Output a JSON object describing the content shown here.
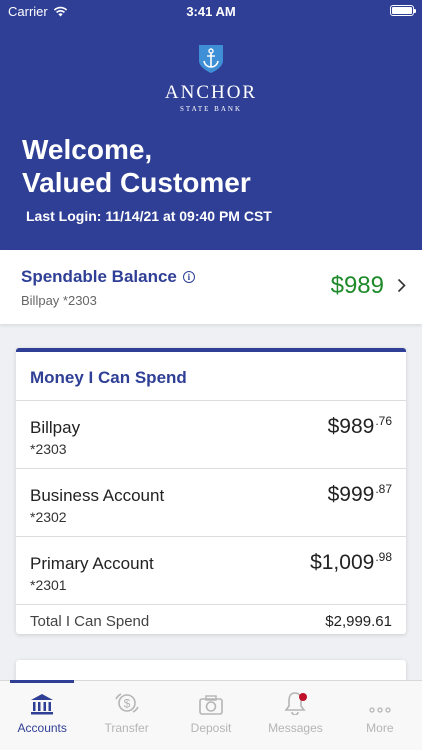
{
  "status_bar": {
    "carrier": "Carrier",
    "time": "3:41 AM"
  },
  "brand": {
    "name": "ANCHOR",
    "subtitle": "STATE BANK"
  },
  "welcome": {
    "line1": "Welcome,",
    "line2": "Valued Customer",
    "last_login": "Last Login: 11/14/21 at 09:40 PM CST"
  },
  "spendable": {
    "title": "Spendable Balance",
    "account": "Billpay *2303",
    "amount": "$989"
  },
  "money_card": {
    "title": "Money I Can Spend",
    "accounts": [
      {
        "name": "Billpay",
        "number": "*2303",
        "dollars": "$989",
        "cents": ".76"
      },
      {
        "name": "Business Account",
        "number": "*2302",
        "dollars": "$999",
        "cents": ".87"
      },
      {
        "name": "Primary Account",
        "number": "*2301",
        "dollars": "$1,009",
        "cents": ".98"
      }
    ],
    "total_label": "Total I Can Spend",
    "total_amount": "$2,999.61"
  },
  "tabs": [
    {
      "label": "Accounts",
      "icon": "bank-icon",
      "active": true
    },
    {
      "label": "Transfer",
      "icon": "transfer-dollar-icon",
      "active": false
    },
    {
      "label": "Deposit",
      "icon": "camera-icon",
      "active": false
    },
    {
      "label": "Messages",
      "icon": "bell-icon",
      "active": false
    },
    {
      "label": "More",
      "icon": "ellipsis-icon",
      "active": false
    }
  ],
  "colors": {
    "brand": "#2f3f96",
    "positive": "#1e8a2a",
    "badge": "#c0102a"
  }
}
